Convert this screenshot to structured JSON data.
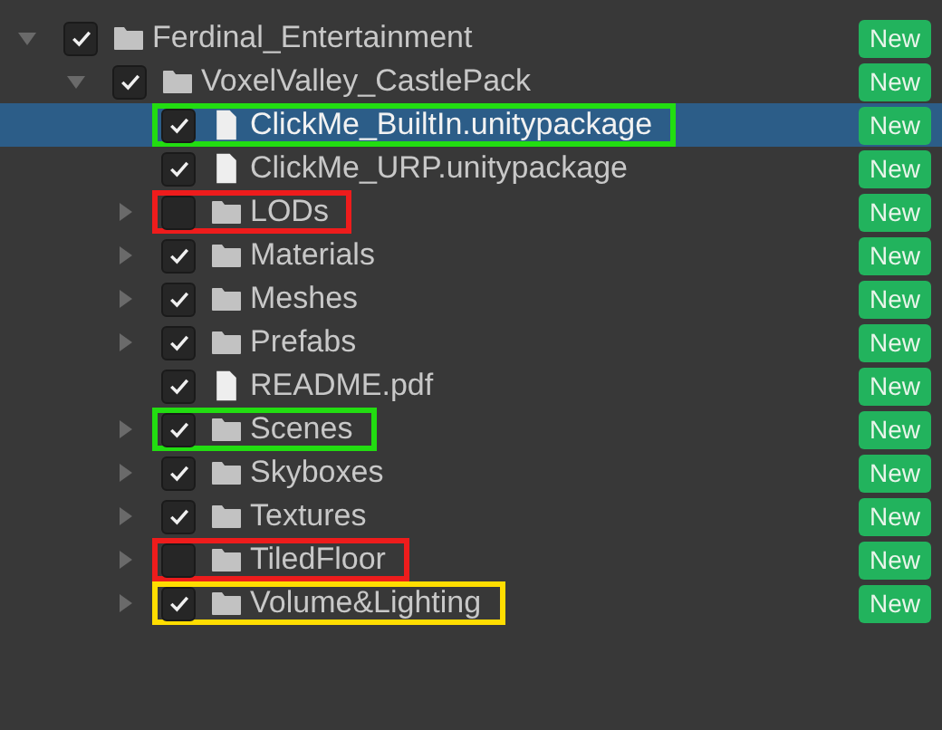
{
  "tree": [
    {
      "kind": "folder",
      "label": "Ferdinal_Entertainment",
      "expanded": true,
      "checked": true,
      "selected": false,
      "badge": "New",
      "children": [
        {
          "kind": "folder",
          "label": "VoxelValley_CastlePack",
          "expanded": true,
          "checked": true,
          "selected": false,
          "badge": "New",
          "children": [
            {
              "kind": "file",
              "label": "ClickMe_BuiltIn.unitypackage",
              "checked": true,
              "selected": true,
              "color": "#22dd11",
              "badge": "New"
            },
            {
              "kind": "file",
              "label": "ClickMe_URP.unitypackage",
              "checked": true,
              "selected": false,
              "badge": "New"
            },
            {
              "kind": "folder",
              "label": "LODs",
              "expanded": false,
              "checked": false,
              "selected": false,
              "color": "#ee1c1c",
              "badge": "New"
            },
            {
              "kind": "folder",
              "label": "Materials",
              "expanded": false,
              "checked": true,
              "selected": false,
              "badge": "New"
            },
            {
              "kind": "folder",
              "label": "Meshes",
              "expanded": false,
              "checked": true,
              "selected": false,
              "badge": "New"
            },
            {
              "kind": "folder",
              "label": "Prefabs",
              "expanded": false,
              "checked": true,
              "selected": false,
              "badge": "New"
            },
            {
              "kind": "file",
              "label": "README.pdf",
              "checked": true,
              "selected": false,
              "badge": "New"
            },
            {
              "kind": "folder",
              "label": "Scenes",
              "expanded": false,
              "checked": true,
              "selected": false,
              "color": "#22dd11",
              "badge": "New"
            },
            {
              "kind": "folder",
              "label": "Skyboxes",
              "expanded": false,
              "checked": true,
              "selected": false,
              "badge": "New"
            },
            {
              "kind": "folder",
              "label": "Textures",
              "expanded": false,
              "checked": true,
              "selected": false,
              "badge": "New"
            },
            {
              "kind": "folder",
              "label": "TiledFloor",
              "expanded": false,
              "checked": false,
              "selected": false,
              "color": "#ee1c1c",
              "badge": "New"
            },
            {
              "kind": "folder",
              "label": "Volume&Lighting",
              "expanded": false,
              "checked": true,
              "selected": false,
              "color": "#ffdd00",
              "badge": "New"
            }
          ]
        }
      ]
    }
  ]
}
